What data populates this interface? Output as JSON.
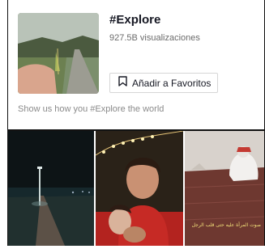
{
  "hashtag": {
    "title": "#Explore",
    "views": "927.5B visualizaciones",
    "favorite_label": "Añadir a Favoritos",
    "description": "Show us how you #Explore the world"
  },
  "videos": [
    {
      "thumbnail": "night-pier-lake-scene"
    },
    {
      "thumbnail": "young-man-selfie-with-string-lights"
    },
    {
      "thumbnail": "man-praying-on-carpet",
      "caption": "صوت المرأة عليه حتى قلب الرجل"
    }
  ],
  "colors": {
    "text": "#161823",
    "muted": "#8a8a8a",
    "border": "#d6d6d6"
  },
  "icons": {
    "favorite": "bookmark-icon"
  }
}
